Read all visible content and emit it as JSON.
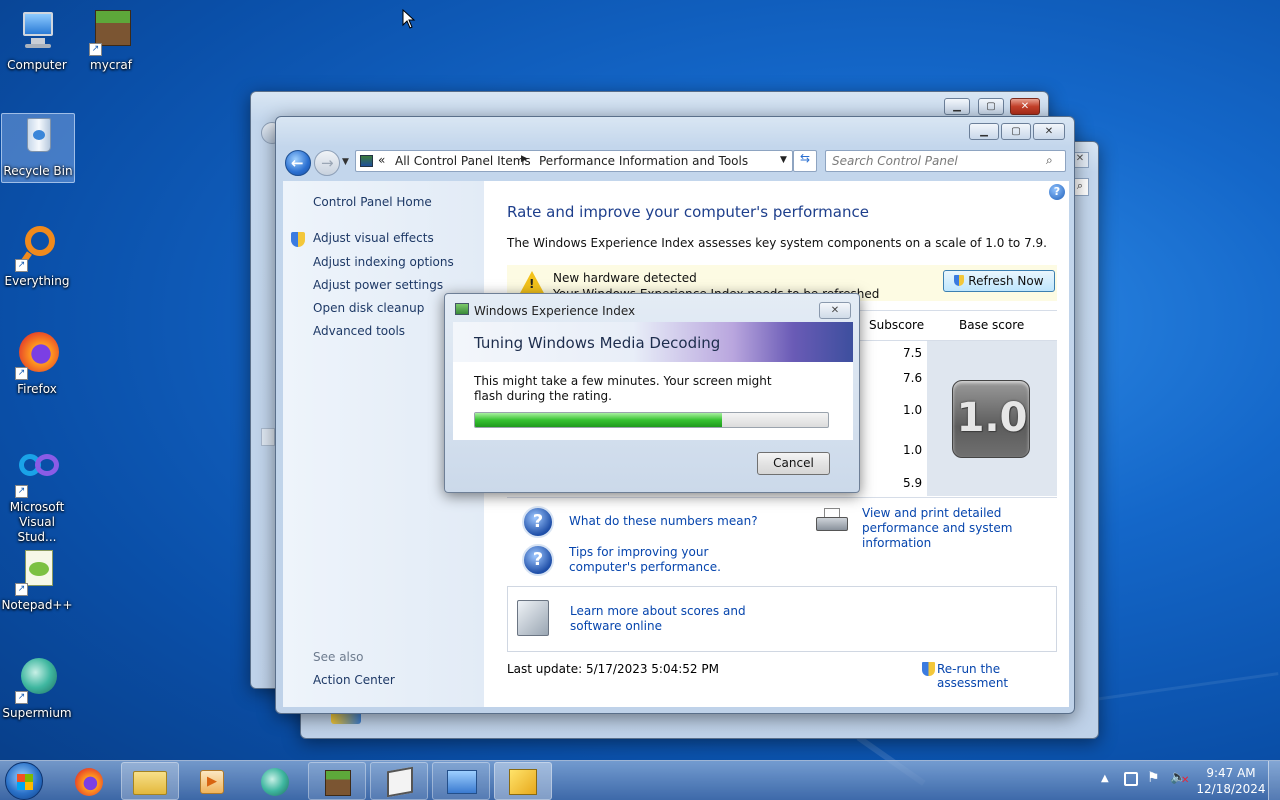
{
  "desktop": {
    "icons": [
      {
        "label": "Computer"
      },
      {
        "label": "mycraf"
      },
      {
        "label": "Recycle Bin"
      },
      {
        "label": "Everything"
      },
      {
        "label": "Firefox"
      },
      {
        "label": "Microsoft Visual Stud..."
      },
      {
        "label": "Notepad++"
      },
      {
        "label": "Supermium"
      }
    ]
  },
  "main_window": {
    "breadcrumb_sep": "«",
    "breadcrumb": [
      "All Control Panel Items",
      "Performance Information and Tools"
    ],
    "search_placeholder": "Search Control Panel",
    "left_pane": {
      "home": "Control Panel Home",
      "links": [
        "Adjust visual effects",
        "Adjust indexing options",
        "Adjust power settings",
        "Open disk cleanup",
        "Advanced tools"
      ],
      "see_also_header": "See also",
      "see_also": [
        "Action Center"
      ]
    },
    "heading": "Rate and improve your computer's performance",
    "description": "The Windows Experience Index assesses key system components on a scale of 1.0 to 7.9.",
    "banner": {
      "title": "New hardware detected",
      "subtitle": "Your Windows Experience Index needs to be refreshed",
      "button": "Refresh Now"
    },
    "table": {
      "col_subscore": "Subscore",
      "col_basescore": "Base score",
      "subscores": [
        "7.5",
        "7.6",
        "1.0",
        "1.0",
        "5.9"
      ],
      "base_score": "1.0"
    },
    "links": {
      "numbers": "What do these numbers mean?",
      "tips": "Tips for improving your computer's performance.",
      "print": "View and print detailed performance and system information",
      "learn": "Learn more about scores and software online"
    },
    "last_update": "Last update: 5/17/2023 5:04:52 PM",
    "rerun": "Re-run the assessment"
  },
  "dialog": {
    "title": "Windows Experience Index",
    "header": "Tuning Windows Media Decoding",
    "message": "This might take a few minutes. Your screen might flash during the rating.",
    "progress": 0.7,
    "cancel": "Cancel"
  },
  "taskbar": {
    "time": "9:47 AM",
    "date": "12/18/2024"
  }
}
